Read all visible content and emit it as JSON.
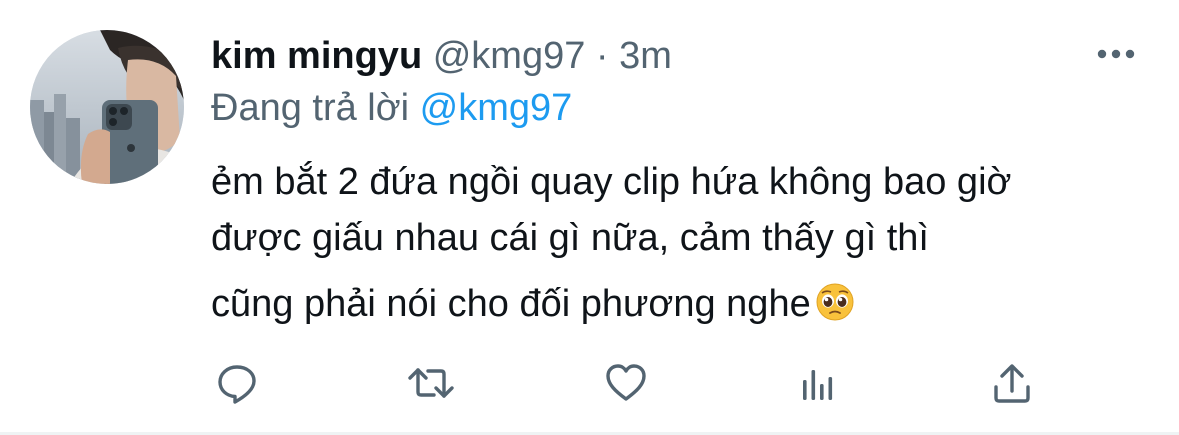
{
  "tweet": {
    "author_name": "kim mingyu",
    "author_handle": "@kmg97",
    "separator": "·",
    "time": "3m",
    "replying_prefix": "Đang trả lời ",
    "replying_to": "@kmg97",
    "body_lines": [
      "ẻm bắt 2 đứa ngồi quay clip hứa không bao giờ",
      "được giấu nhau cái gì nữa, cảm thấy gì thì",
      "cũng phải nói cho đối phương nghe"
    ],
    "body_emoji": "pleading-face-emoji"
  },
  "actions": [
    {
      "name": "reply",
      "icon": "reply-icon"
    },
    {
      "name": "retweet",
      "icon": "retweet-icon"
    },
    {
      "name": "like",
      "icon": "heart-icon"
    },
    {
      "name": "analytics",
      "icon": "analytics-icon"
    },
    {
      "name": "share",
      "icon": "share-icon"
    }
  ],
  "colors": {
    "text": "#0f1419",
    "secondary": "#536471",
    "accent": "#1d9bf0",
    "divider": "#eff3f4"
  }
}
